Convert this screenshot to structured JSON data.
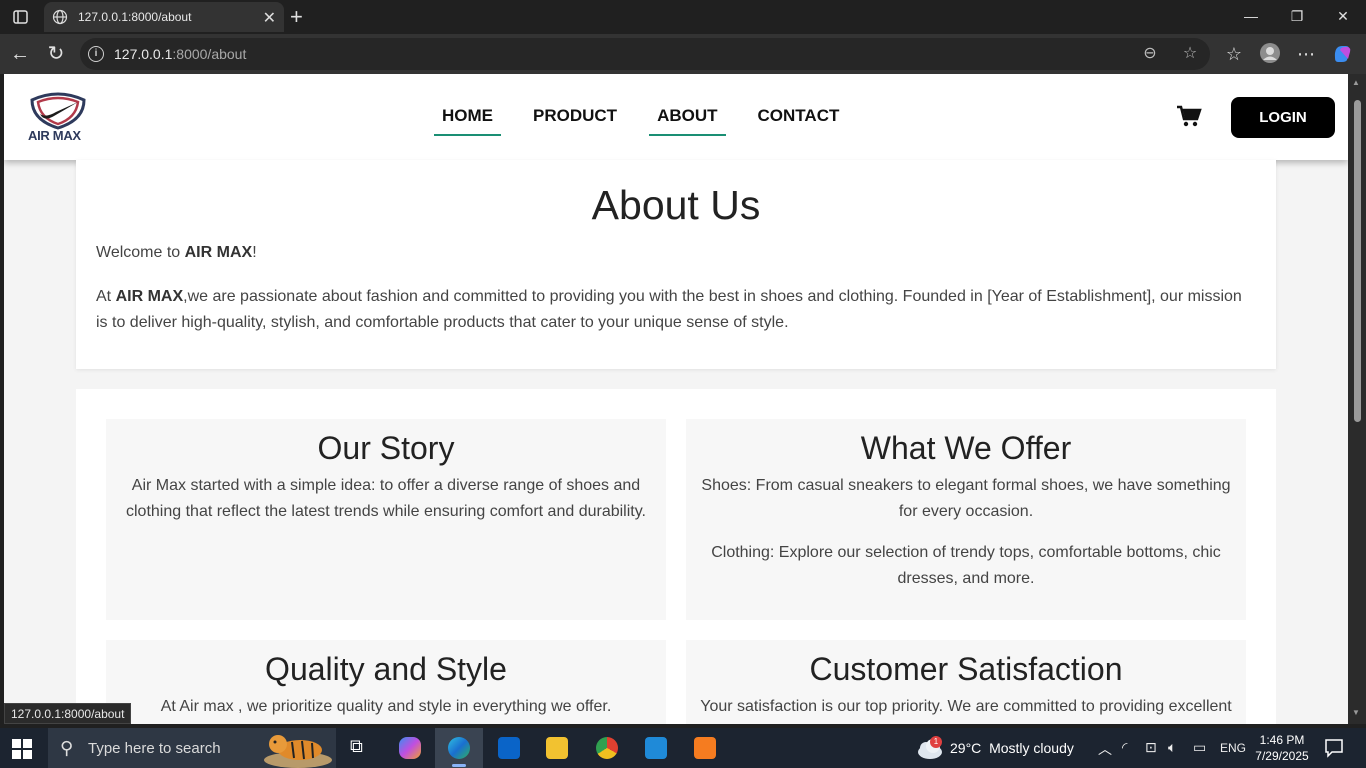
{
  "browser": {
    "tab_title": "127.0.0.1:8000/about",
    "url_host": "127.0.0.1",
    "url_path": ":8000/about",
    "status_url": "127.0.0.1:8000/about"
  },
  "site": {
    "logo_text": "AIR MAX",
    "nav": [
      {
        "label": "HOME",
        "active": true
      },
      {
        "label": "PRODUCT",
        "active": false
      },
      {
        "label": "ABOUT",
        "active": true
      },
      {
        "label": "CONTACT",
        "active": false
      }
    ],
    "login_label": "LOGIN",
    "accent_color": "#1a8f74"
  },
  "about": {
    "title": "About Us",
    "welcome_prefix": "Welcome to ",
    "welcome_brand": "AIR MAX",
    "welcome_suffix": "!",
    "intro_prefix": "At ",
    "intro_brand": "AIR MAX",
    "intro_rest": ",we are passionate about fashion and committed to providing you with the best in shoes and clothing. Founded in [Year of Establishment], our mission is to deliver high-quality, stylish, and comfortable products that cater to your unique sense of style."
  },
  "sections": {
    "story": {
      "title": "Our Story",
      "text": "Air Max started with a simple idea: to offer a diverse range of shoes and clothing that reflect the latest trends while ensuring comfort and durability."
    },
    "offer": {
      "title": "What We Offer",
      "shoes": "Shoes: From casual sneakers to elegant formal shoes, we have something for every occasion.",
      "clothing": "Clothing: Explore our selection of trendy tops, comfortable bottoms, chic dresses, and more."
    },
    "quality": {
      "title": "Quality and Style",
      "text": "At Air max , we prioritize quality and style in everything we offer."
    },
    "satisfaction": {
      "title": "Customer Satisfaction",
      "text": "Your satisfaction is our top priority. We are committed to providing excellent"
    }
  },
  "taskbar": {
    "search_placeholder": "Type here to search",
    "weather_temp": "29°C",
    "weather_desc": "Mostly cloudy",
    "weather_badge": "1",
    "language": "ENG",
    "time": "1:46 PM",
    "date": "7/29/2025"
  }
}
